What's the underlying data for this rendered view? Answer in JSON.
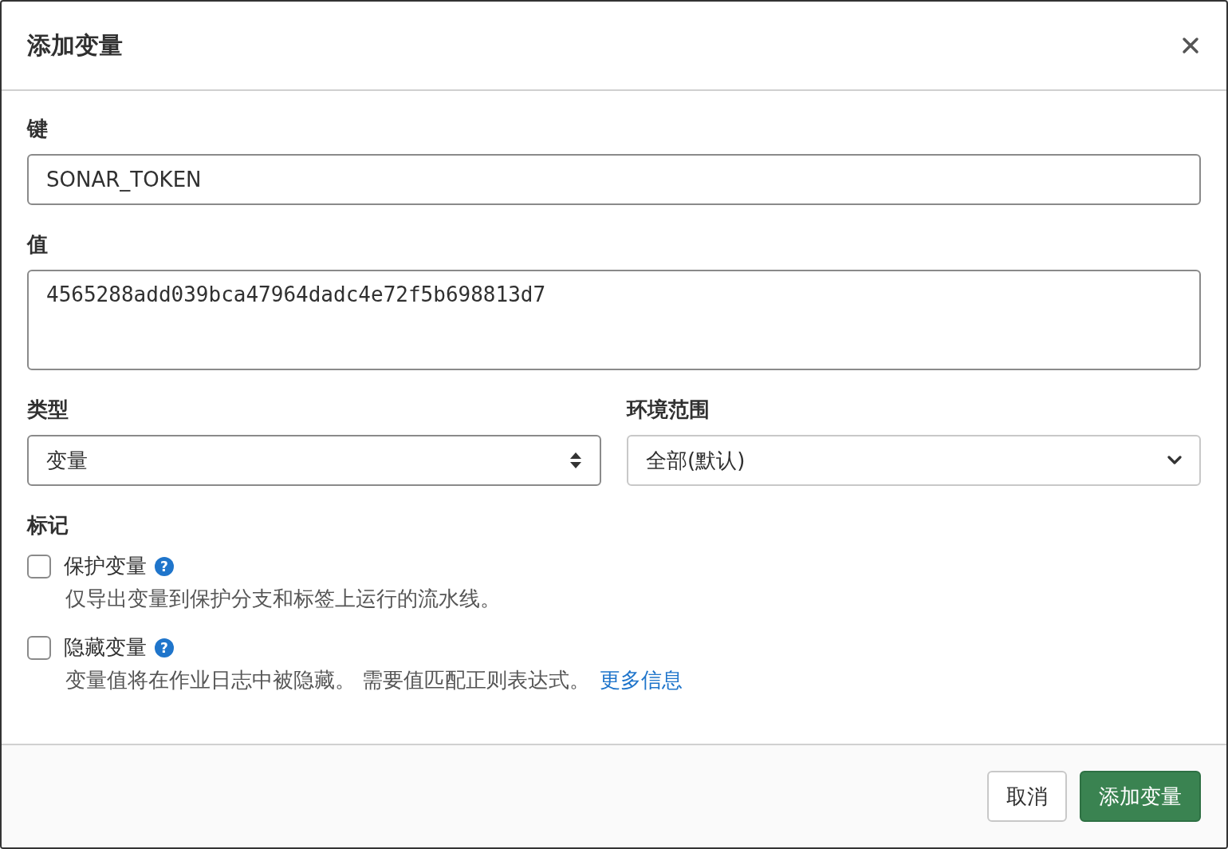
{
  "dialog": {
    "title": "添加变量"
  },
  "key_field": {
    "label": "键",
    "value": "SONAR_TOKEN"
  },
  "value_field": {
    "label": "值",
    "value": "4565288add039bca47964dadc4e72f5b698813d7"
  },
  "type_select": {
    "label": "类型",
    "value": "变量"
  },
  "scope_select": {
    "label": "环境范围",
    "value": "全部(默认)"
  },
  "flags": {
    "label": "标记",
    "items": [
      {
        "label": "保护变量",
        "checked": false,
        "help": "?",
        "description": "仅导出变量到保护分支和标签上运行的流水线。"
      },
      {
        "label": "隐藏变量",
        "checked": false,
        "help": "?",
        "description": "变量值将在作业日志中被隐藏。 需要值匹配正则表达式。",
        "link": "更多信息"
      }
    ]
  },
  "buttons": [
    {
      "label": "取消",
      "kind": "secondary"
    },
    {
      "label": "添加变量",
      "kind": "primary"
    }
  ]
}
